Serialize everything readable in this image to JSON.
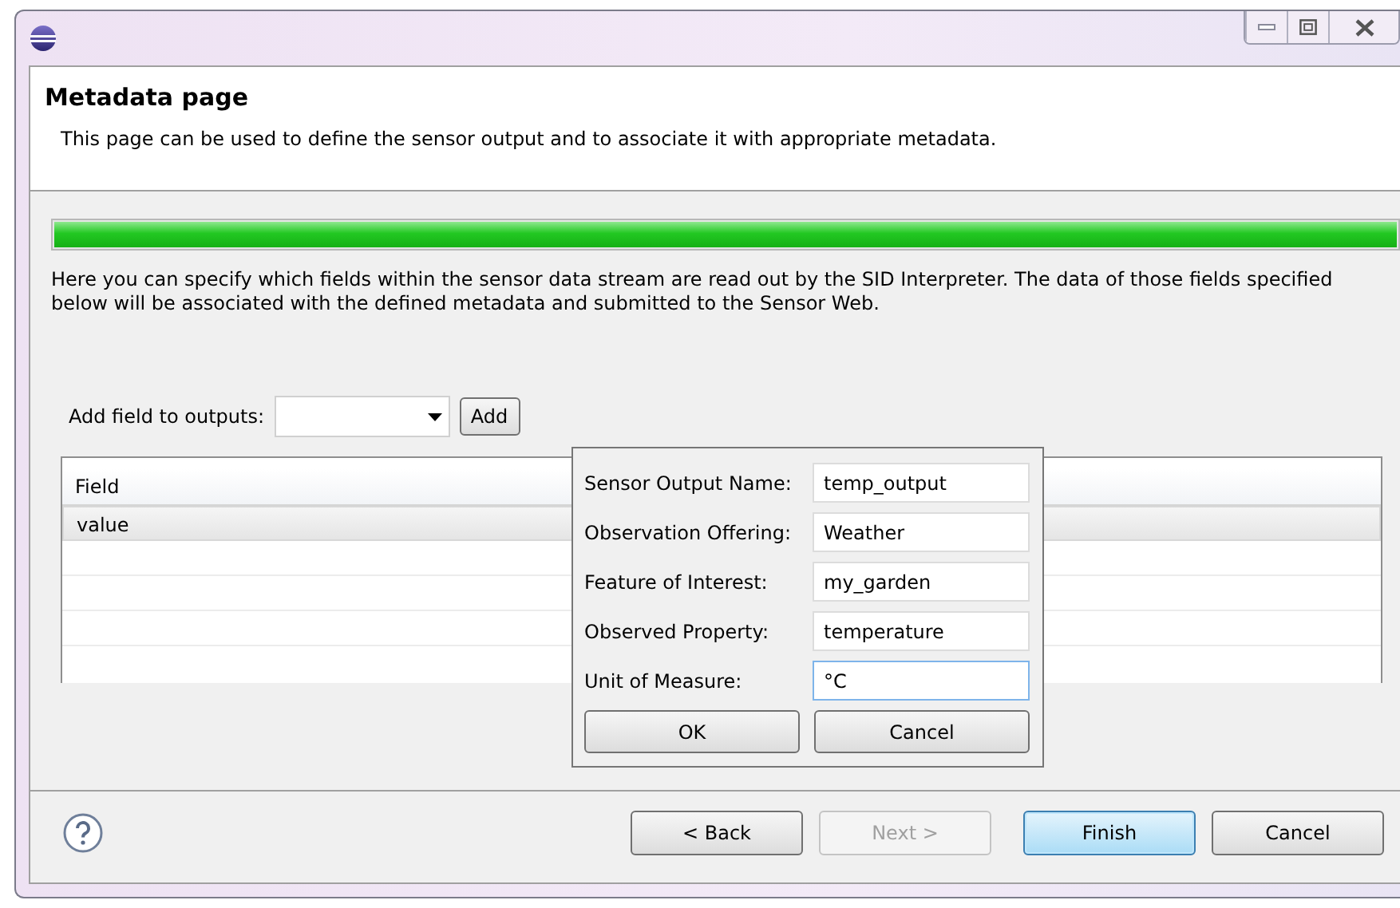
{
  "header": {
    "title": "Metadata page",
    "description": "This page can be used to define the sensor output and to associate it with appropriate metadata."
  },
  "progress": {
    "level": 1
  },
  "intro": "Here you can specify which fields within the sensor data stream are read out by the SID Interpreter. The data of those fields specified below will be associated with the defined metadata and submitted to the Sensor Web.",
  "add_field": {
    "label": "Add field to outputs:",
    "button": "Add"
  },
  "table": {
    "columns": [
      "Field"
    ],
    "rows": [
      {
        "field": "value",
        "selected": true
      }
    ]
  },
  "popup": {
    "fields": [
      {
        "label": "Sensor Output Name:",
        "value": "temp_output",
        "focused": false
      },
      {
        "label": "Observation Offering:",
        "value": "Weather",
        "focused": false
      },
      {
        "label": "Feature of Interest:",
        "value": "my_garden",
        "focused": false
      },
      {
        "label": "Observed Property:",
        "value": "temperature",
        "focused": false
      },
      {
        "label": "Unit of Measure:",
        "value": "°C",
        "focused": true
      }
    ],
    "buttons": [
      "OK",
      "Cancel"
    ]
  },
  "footer": {
    "buttons": [
      {
        "label": "< Back",
        "disabled": false,
        "default": false
      },
      {
        "label": "Next >",
        "disabled": true,
        "default": false
      },
      {
        "label": "Finish",
        "disabled": false,
        "default": true
      },
      {
        "label": "Cancel",
        "disabled": false,
        "default": false
      }
    ]
  }
}
